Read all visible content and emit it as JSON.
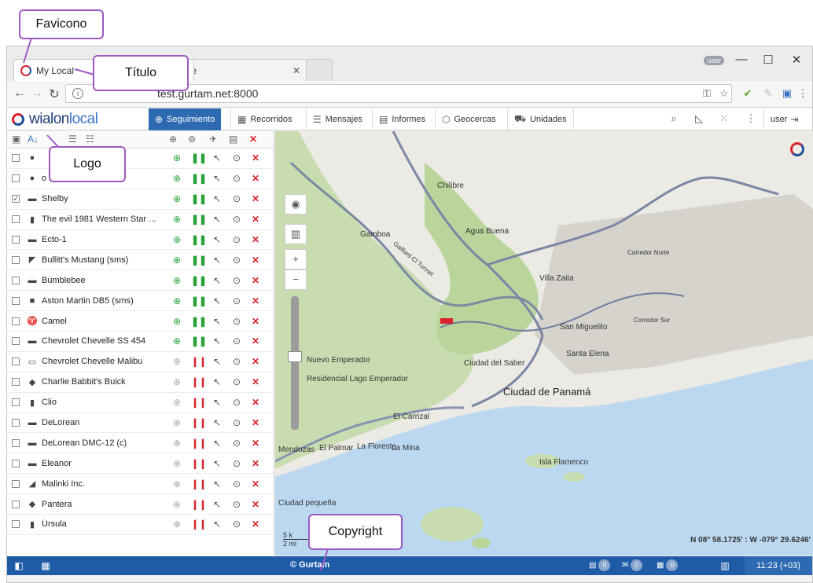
{
  "callouts": {
    "favicon": "Favicono",
    "title": "Título",
    "logo": "Logo",
    "copyright": "Copyright"
  },
  "browser": {
    "active_tab_title": "My Local",
    "inactive_tab_title": "gle",
    "user_badge": "user",
    "address": "test.gurtam.net:8000"
  },
  "app": {
    "logo_bold": "wialon",
    "logo_thin": "local",
    "modules": [
      {
        "label": "Seguimiento",
        "icon": "⊕"
      },
      {
        "label": "Recorridos",
        "icon": "▦"
      },
      {
        "label": "Mensajes",
        "icon": "☰"
      },
      {
        "label": "Informes",
        "icon": "▤"
      },
      {
        "label": "Geocercas",
        "icon": "⬡"
      },
      {
        "label": "Unidades",
        "icon": "⛟"
      }
    ],
    "user_menu": "user"
  },
  "units": [
    {
      "name": "",
      "checked": false,
      "icon": "●",
      "online": true,
      "moving": "go"
    },
    {
      "name": "o Lowr...",
      "checked": false,
      "icon": "●",
      "online": true,
      "moving": "go"
    },
    {
      "name": "Shelby",
      "checked": true,
      "icon": "▬",
      "online": true,
      "moving": "go"
    },
    {
      "name": "The evil 1981 Western Star ...",
      "checked": false,
      "icon": "▮",
      "online": true,
      "moving": "go"
    },
    {
      "name": "Ecto-1",
      "checked": false,
      "icon": "▬",
      "online": true,
      "moving": "go"
    },
    {
      "name": "Bullitt's Mustang (sms)",
      "checked": false,
      "icon": "◤",
      "online": true,
      "moving": "go"
    },
    {
      "name": "Bumblebee",
      "checked": false,
      "icon": "▬",
      "online": true,
      "moving": "go"
    },
    {
      "name": "Aston Martin DB5 (sms)",
      "checked": false,
      "icon": "■",
      "online": true,
      "moving": "go"
    },
    {
      "name": "Camel",
      "checked": false,
      "icon": "♈",
      "online": true,
      "moving": "go"
    },
    {
      "name": "Chevrolet Chevelle SS 454",
      "checked": false,
      "icon": "▬",
      "online": true,
      "moving": "go"
    },
    {
      "name": "Chevrolet Chevelle Malibu",
      "checked": false,
      "icon": "▭",
      "online": false,
      "moving": "stop"
    },
    {
      "name": "Charlie Babbit's Buick",
      "checked": false,
      "icon": "◆",
      "online": false,
      "moving": "stop"
    },
    {
      "name": "Clio",
      "checked": false,
      "icon": "▮",
      "online": false,
      "moving": "stop"
    },
    {
      "name": "DeLorean",
      "checked": false,
      "icon": "▬",
      "online": false,
      "moving": "stop"
    },
    {
      "name": "DeLorean DMC-12 (c)",
      "checked": false,
      "icon": "▬",
      "online": false,
      "moving": "stop"
    },
    {
      "name": "Eleanor",
      "checked": false,
      "icon": "▬",
      "online": false,
      "moving": "stop"
    },
    {
      "name": "Malinki Inc.",
      "checked": false,
      "icon": "◢",
      "online": false,
      "moving": "stop"
    },
    {
      "name": "Pantera",
      "checked": false,
      "icon": "◆",
      "online": false,
      "moving": "stop"
    },
    {
      "name": "Úrsula",
      "checked": false,
      "icon": "▮",
      "online": false,
      "moving": "stop"
    }
  ],
  "map": {
    "labels": [
      "Chilibre",
      "Gamboa",
      "Agua Buena",
      "Villa Zaita",
      "Corredor Norte",
      "Corredor Sur",
      "San Miguelito",
      "Santa Elena",
      "Nuevo Emperador",
      "Ciudad del Saber",
      "Residencial Lago Emperador",
      "Ciudad de Panamá",
      "El Carrizal",
      "Mendozas",
      "El Palmar",
      "La Floresta",
      "La Mina",
      "Isla Flamenco",
      "Ciudad pequeña",
      "Gaillard Cl Tunnel"
    ],
    "coords": "N 08° 58.1725' : W -079° 29.6246'",
    "scale_top": "5 k",
    "scale_bottom": "2 mi"
  },
  "status": {
    "copyright": "© Gurtam",
    "counter1": "0",
    "counter2": "0",
    "counter3": "0",
    "time": "11:23 (+03)"
  }
}
